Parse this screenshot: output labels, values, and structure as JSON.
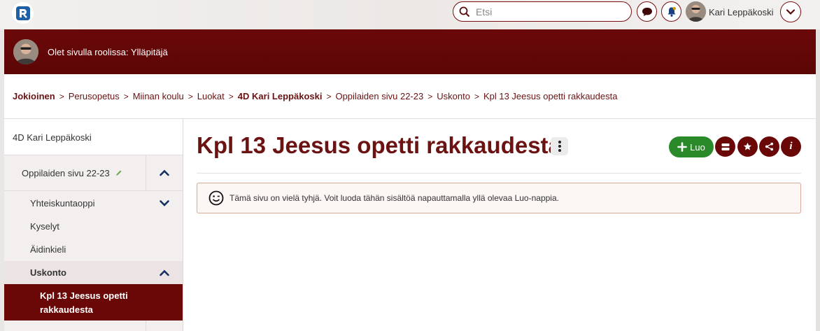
{
  "topbar": {
    "search_placeholder": "Etsi",
    "user_name": "Kari Leppäkoski"
  },
  "role": {
    "text": "Olet sivulla roolissa: Ylläpitäjä"
  },
  "breadcrumb": [
    "Jokioinen",
    "Perusopetus",
    "Miinan koulu",
    "Luokat",
    "4D Kari Leppäkoski",
    "Oppilaiden sivu 22-23",
    "Uskonto",
    "Kpl 13 Jeesus opetti rakkaudesta"
  ],
  "sidebar": {
    "header": "4D Kari Leppäkoski",
    "items": [
      {
        "label": "Oppilaiden sivu 22-23"
      },
      {
        "label": "Yhteiskuntaoppi"
      },
      {
        "label": "Kyselyt"
      },
      {
        "label": "Äidinkieli"
      },
      {
        "label": "Uskonto"
      },
      {
        "label": "Kpl 13 Jeesus opetti rakkaudesta"
      }
    ]
  },
  "main": {
    "title": "Kpl 13 Jeesus opetti rakkaudesta",
    "create_label": "Luo",
    "notice": "Tämä sivu on vielä tyhjä. Voit luoda tähän sisältöä napauttamalla yllä olevaa Luo-nappia."
  },
  "colors": {
    "brand": "#6a0808",
    "create": "#2a8a2a"
  }
}
